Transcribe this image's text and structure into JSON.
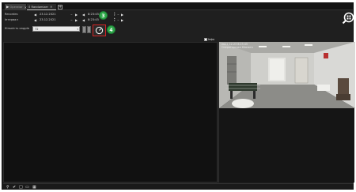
{
  "tabs": [
    {
      "label": "Operator",
      "icon": "camera-icon",
      "close": "✕"
    },
    {
      "label": "Randomizer",
      "icon": "search-icon",
      "close": "✕"
    }
  ],
  "tab_add": "+",
  "controls": {
    "row1": {
      "label": "Recordes",
      "date": "23.12.2021",
      "time": "8:23:45"
    },
    "row2": {
      "label": "Інтервал",
      "date": "23.12.2021",
      "time": "8:23:45"
    },
    "row3": {
      "label": "Кількість кадрів",
      "value": "72"
    }
  },
  "badges": {
    "first": "3",
    "second": "4"
  },
  "mini_toggle": {
    "label": "Інфо"
  },
  "video": {
    "header_line1": "2021-12-23 8:23:45",
    "header_line2": "Операторська Кімната"
  },
  "status_icons": [
    "pin-icon",
    "check-icon",
    "square-icon",
    "window-icon",
    "grid-icon"
  ],
  "colors": {
    "accent_red": "#d42424",
    "badge_green": "#2fa84a",
    "background": "#1f1f1f"
  }
}
